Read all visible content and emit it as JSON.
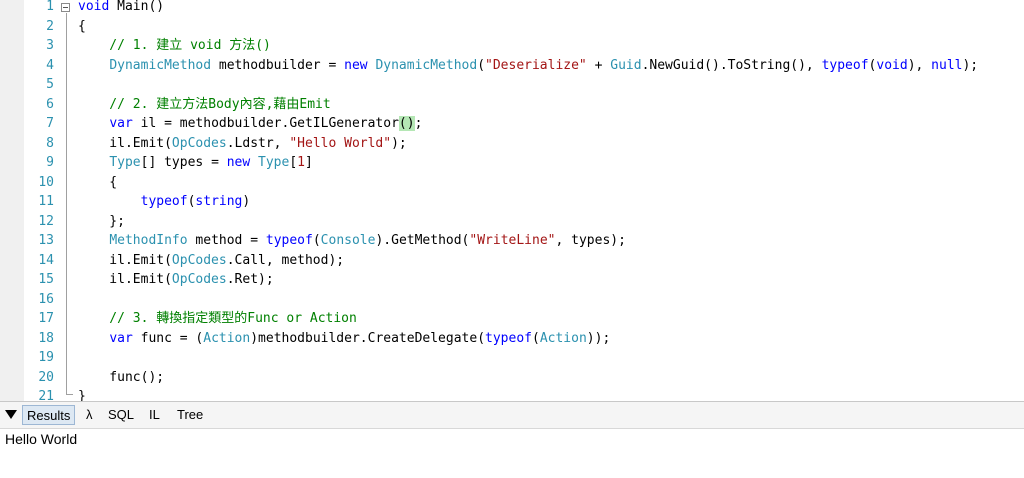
{
  "editor": {
    "line_numbers": [
      "1",
      "2",
      "3",
      "4",
      "5",
      "6",
      "7",
      "8",
      "9",
      "10",
      "11",
      "12",
      "13",
      "14",
      "15",
      "16",
      "17",
      "18",
      "19",
      "20",
      "21"
    ],
    "lines": [
      [
        {
          "t": "void",
          "c": "kw"
        },
        {
          "t": " Main()",
          "c": ""
        }
      ],
      [
        {
          "t": "{",
          "c": ""
        }
      ],
      [
        {
          "t": "    // 1. 建立 void 方法()",
          "c": "cm"
        }
      ],
      [
        {
          "t": "    ",
          "c": ""
        },
        {
          "t": "DynamicMethod",
          "c": "ty"
        },
        {
          "t": " methodbuilder = ",
          "c": ""
        },
        {
          "t": "new",
          "c": "kw"
        },
        {
          "t": " ",
          "c": ""
        },
        {
          "t": "DynamicMethod",
          "c": "ty"
        },
        {
          "t": "(",
          "c": ""
        },
        {
          "t": "\"Deserialize\"",
          "c": "st"
        },
        {
          "t": " + ",
          "c": ""
        },
        {
          "t": "Guid",
          "c": "ty"
        },
        {
          "t": ".NewGuid().ToString(), ",
          "c": ""
        },
        {
          "t": "typeof",
          "c": "kw"
        },
        {
          "t": "(",
          "c": ""
        },
        {
          "t": "void",
          "c": "kw"
        },
        {
          "t": "), ",
          "c": ""
        },
        {
          "t": "null",
          "c": "kw"
        },
        {
          "t": ");",
          "c": ""
        }
      ],
      [],
      [
        {
          "t": "    // 2. 建立方法Body內容,藉由Emit",
          "c": "cm"
        }
      ],
      [
        {
          "t": "    ",
          "c": ""
        },
        {
          "t": "var",
          "c": "kw"
        },
        {
          "t": " il = methodbuilder.GetILGenerator",
          "c": ""
        },
        {
          "t": "()",
          "c": "hl"
        },
        {
          "t": ";",
          "c": ""
        }
      ],
      [
        {
          "t": "    il.Emit(",
          "c": ""
        },
        {
          "t": "OpCodes",
          "c": "ty"
        },
        {
          "t": ".Ldstr, ",
          "c": ""
        },
        {
          "t": "\"Hello World\"",
          "c": "st"
        },
        {
          "t": ");",
          "c": ""
        }
      ],
      [
        {
          "t": "    ",
          "c": ""
        },
        {
          "t": "Type",
          "c": "ty"
        },
        {
          "t": "[] types = ",
          "c": ""
        },
        {
          "t": "new",
          "c": "kw"
        },
        {
          "t": " ",
          "c": ""
        },
        {
          "t": "Type",
          "c": "ty"
        },
        {
          "t": "[",
          "c": ""
        },
        {
          "t": "1",
          "c": "st"
        },
        {
          "t": "]",
          "c": ""
        }
      ],
      [
        {
          "t": "    {",
          "c": ""
        }
      ],
      [
        {
          "t": "        ",
          "c": ""
        },
        {
          "t": "typeof",
          "c": "kw"
        },
        {
          "t": "(",
          "c": ""
        },
        {
          "t": "string",
          "c": "kw"
        },
        {
          "t": ")",
          "c": ""
        }
      ],
      [
        {
          "t": "    };",
          "c": ""
        }
      ],
      [
        {
          "t": "    ",
          "c": ""
        },
        {
          "t": "MethodInfo",
          "c": "ty"
        },
        {
          "t": " method = ",
          "c": ""
        },
        {
          "t": "typeof",
          "c": "kw"
        },
        {
          "t": "(",
          "c": ""
        },
        {
          "t": "Console",
          "c": "ty"
        },
        {
          "t": ").GetMethod(",
          "c": ""
        },
        {
          "t": "\"WriteLine\"",
          "c": "st"
        },
        {
          "t": ", types);",
          "c": ""
        }
      ],
      [
        {
          "t": "    il.Emit(",
          "c": ""
        },
        {
          "t": "OpCodes",
          "c": "ty"
        },
        {
          "t": ".Call, method);",
          "c": ""
        }
      ],
      [
        {
          "t": "    il.Emit(",
          "c": ""
        },
        {
          "t": "OpCodes",
          "c": "ty"
        },
        {
          "t": ".Ret);",
          "c": ""
        }
      ],
      [],
      [
        {
          "t": "    // 3. 轉換指定類型的Func or Action",
          "c": "cm"
        }
      ],
      [
        {
          "t": "    ",
          "c": ""
        },
        {
          "t": "var",
          "c": "kw"
        },
        {
          "t": " func = (",
          "c": ""
        },
        {
          "t": "Action",
          "c": "ty"
        },
        {
          "t": ")methodbuilder.CreateDelegate(",
          "c": ""
        },
        {
          "t": "typeof",
          "c": "kw"
        },
        {
          "t": "(",
          "c": ""
        },
        {
          "t": "Action",
          "c": "ty"
        },
        {
          "t": "));",
          "c": ""
        }
      ],
      [],
      [
        {
          "t": "    func();",
          "c": ""
        }
      ],
      [
        {
          "t": "}",
          "c": ""
        }
      ]
    ]
  },
  "results_panel": {
    "tabs": [
      {
        "label": "Results",
        "active": true
      },
      {
        "label": "λ",
        "active": false
      },
      {
        "label": "SQL",
        "active": false
      },
      {
        "label": "IL",
        "active": false
      },
      {
        "label": "Tree",
        "active": false
      }
    ],
    "collapse_icon": "triangle-down-icon",
    "output": "Hello World"
  },
  "colors": {
    "keyword": "#0000ff",
    "type": "#2b91af",
    "string": "#a31515",
    "comment": "#008000",
    "line_number": "#2b91af",
    "brace_highlight": "#b5e7b5"
  }
}
